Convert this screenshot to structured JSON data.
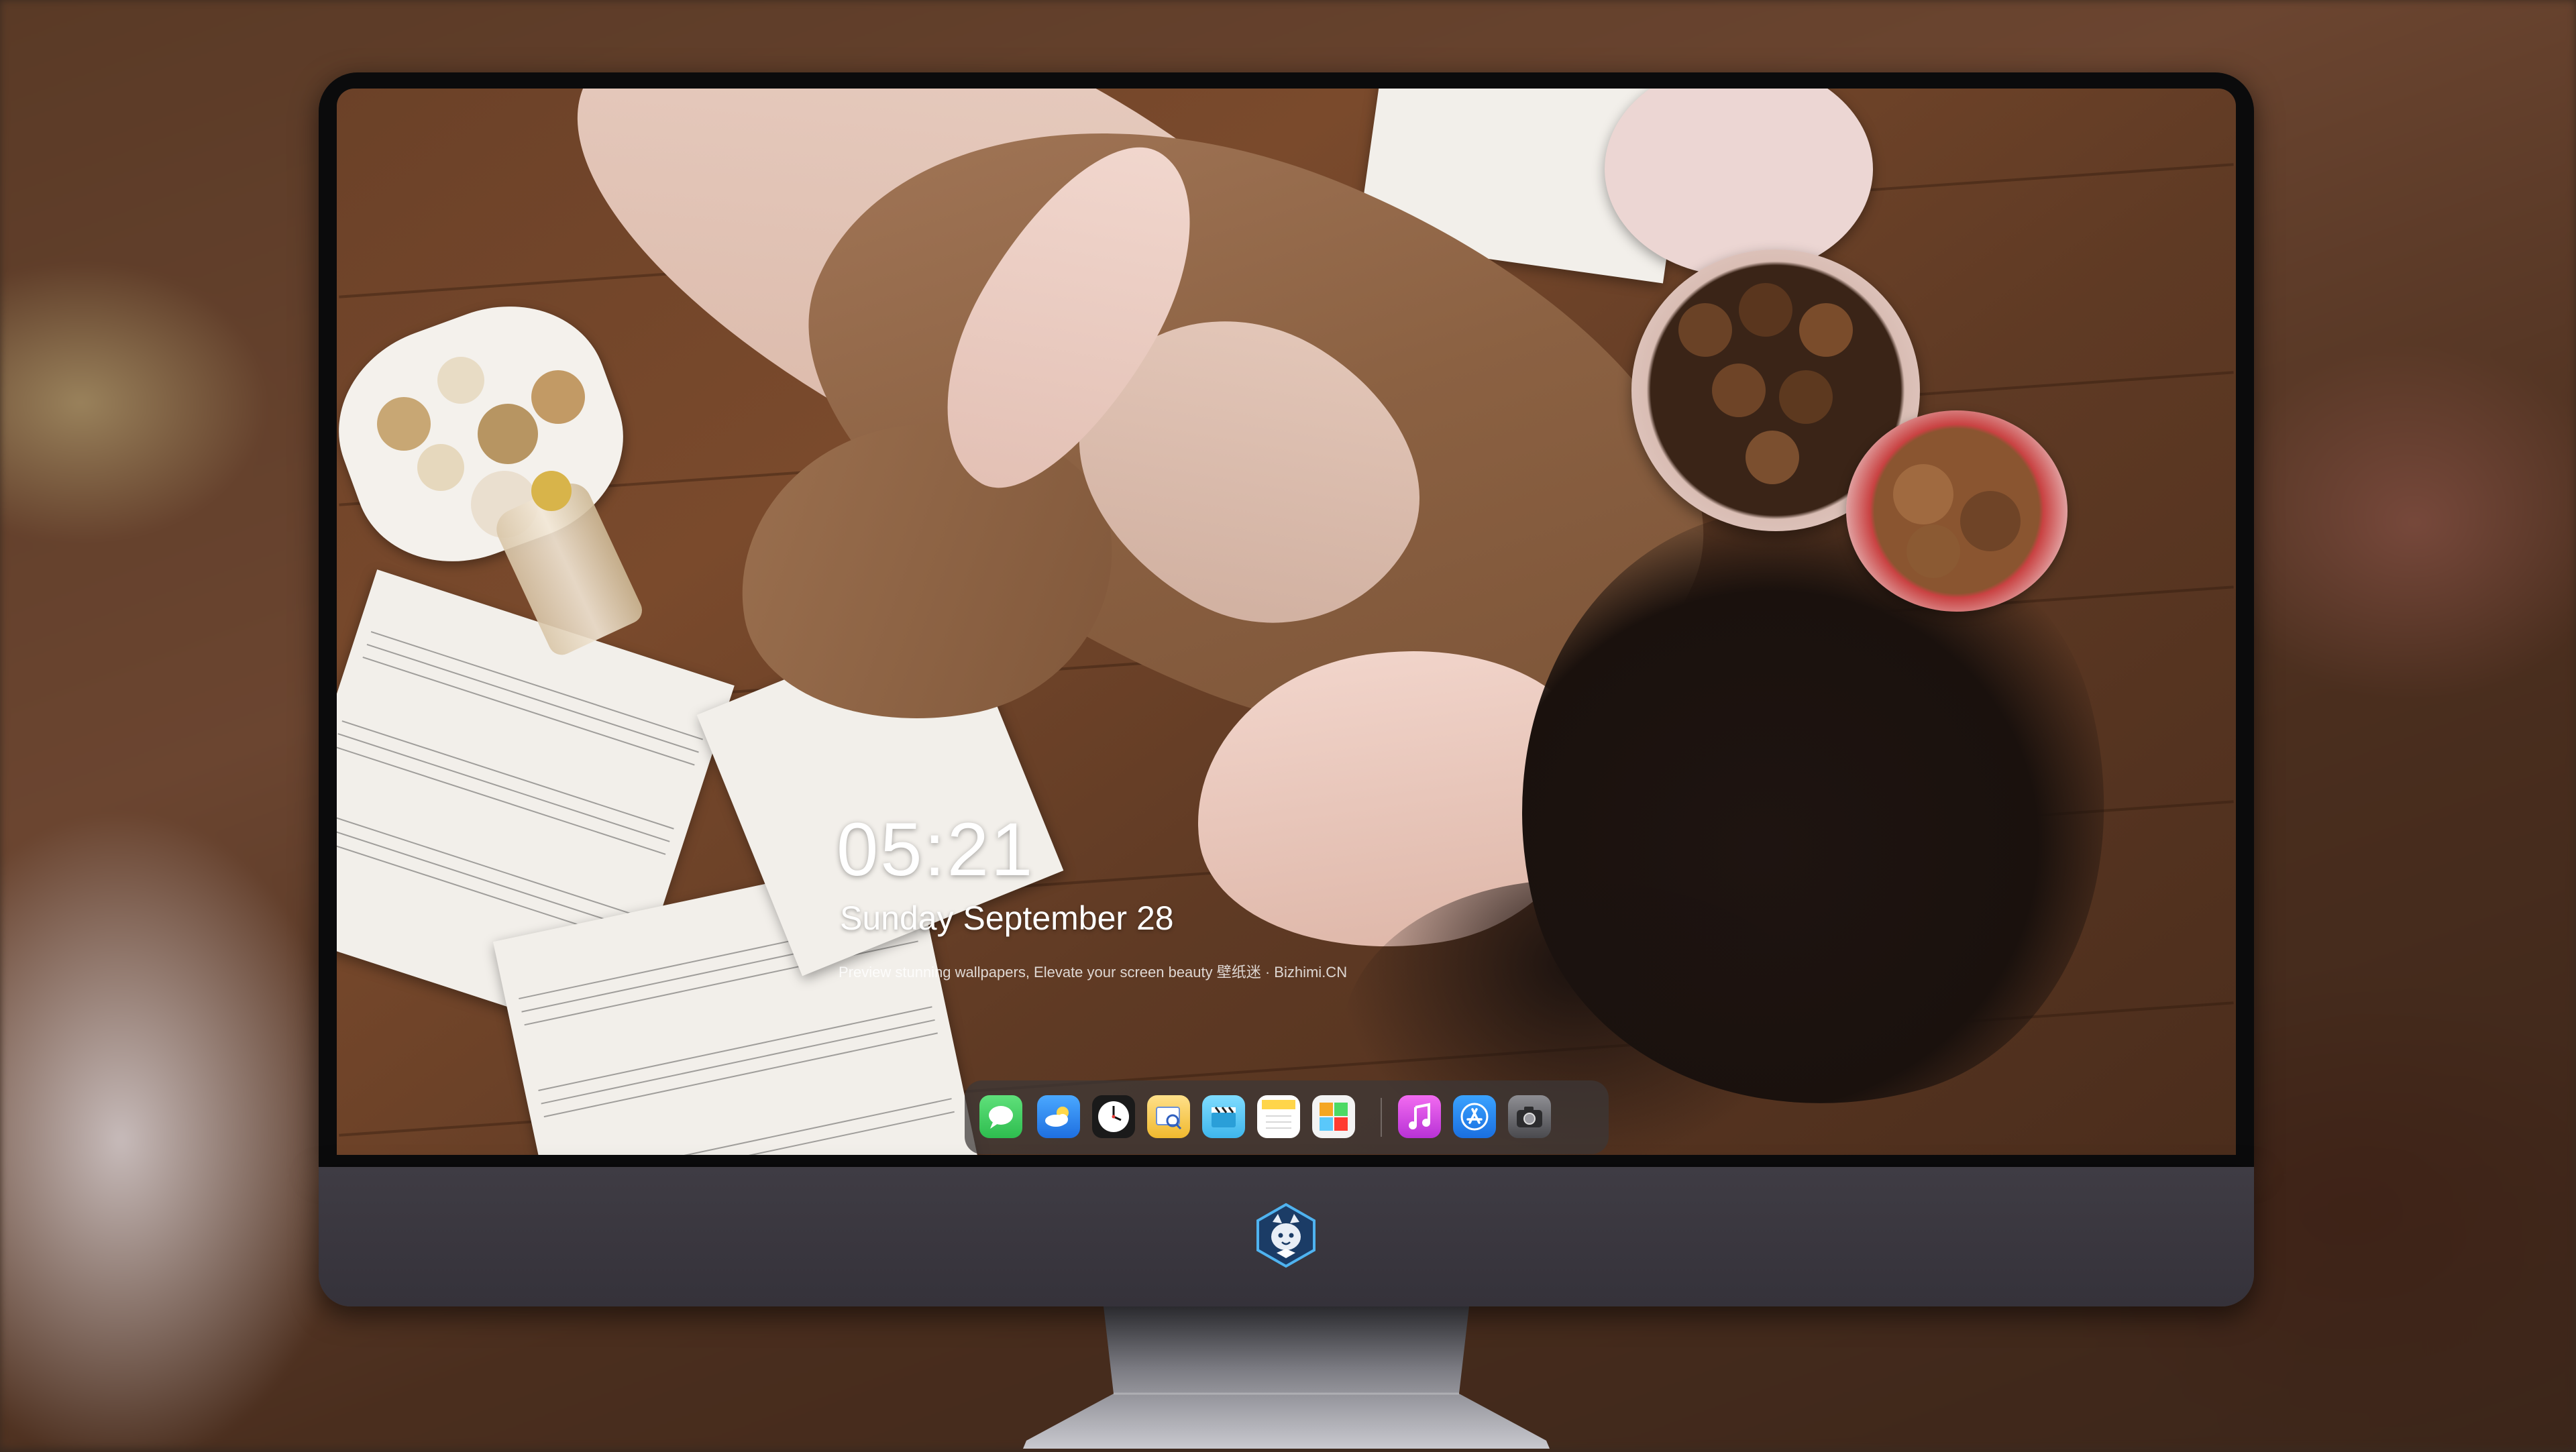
{
  "lockscreen": {
    "time": "05:21",
    "date": "Sunday September  28",
    "tagline": "Preview stunning wallpapers, Elevate your screen beauty  壁纸迷 · Bizhimi.CN"
  },
  "dock": {
    "apps": [
      {
        "name": "Messages",
        "icon": "messages-icon",
        "color": "#34c759"
      },
      {
        "name": "Weather",
        "icon": "weather-icon",
        "color": "#2f8cf5"
      },
      {
        "name": "Clock",
        "icon": "clock-icon",
        "color": "#111111"
      },
      {
        "name": "Preview",
        "icon": "preview-icon",
        "color": "#f4c542"
      },
      {
        "name": "Clips",
        "icon": "clips-icon",
        "color": "#5ac8fa"
      },
      {
        "name": "Notes",
        "icon": "notes-icon",
        "color": "#ffd54a"
      },
      {
        "name": "Photos",
        "icon": "photos-icon",
        "color": "#f2f2f2"
      },
      {
        "name": "Music",
        "icon": "music-icon",
        "color": "#d94fd6"
      },
      {
        "name": "App Store",
        "icon": "app-store-icon",
        "color": "#1e88f5"
      },
      {
        "name": "Camera",
        "icon": "camera-icon",
        "color": "#5b5b5f"
      }
    ]
  },
  "device": {
    "logo": "tiger-mascot-logo"
  }
}
